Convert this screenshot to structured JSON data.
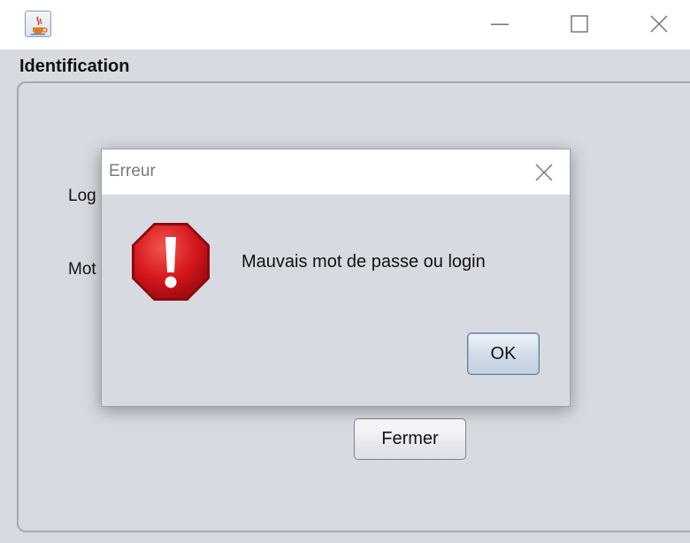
{
  "window": {
    "icon": "java-cup-icon",
    "controls": {
      "minimize": "minimize-icon",
      "maximize": "maximize-icon",
      "close": "close-icon"
    }
  },
  "main": {
    "section_title": "Identification",
    "login_label": "Log",
    "password_label": "Mot",
    "close_button_label": "Fermer"
  },
  "dialog": {
    "title": "Erreur",
    "message": "Mauvais mot de passe ou login",
    "ok_label": "OK",
    "icon": "error-stop-icon",
    "icon_color": "#d4161c"
  }
}
